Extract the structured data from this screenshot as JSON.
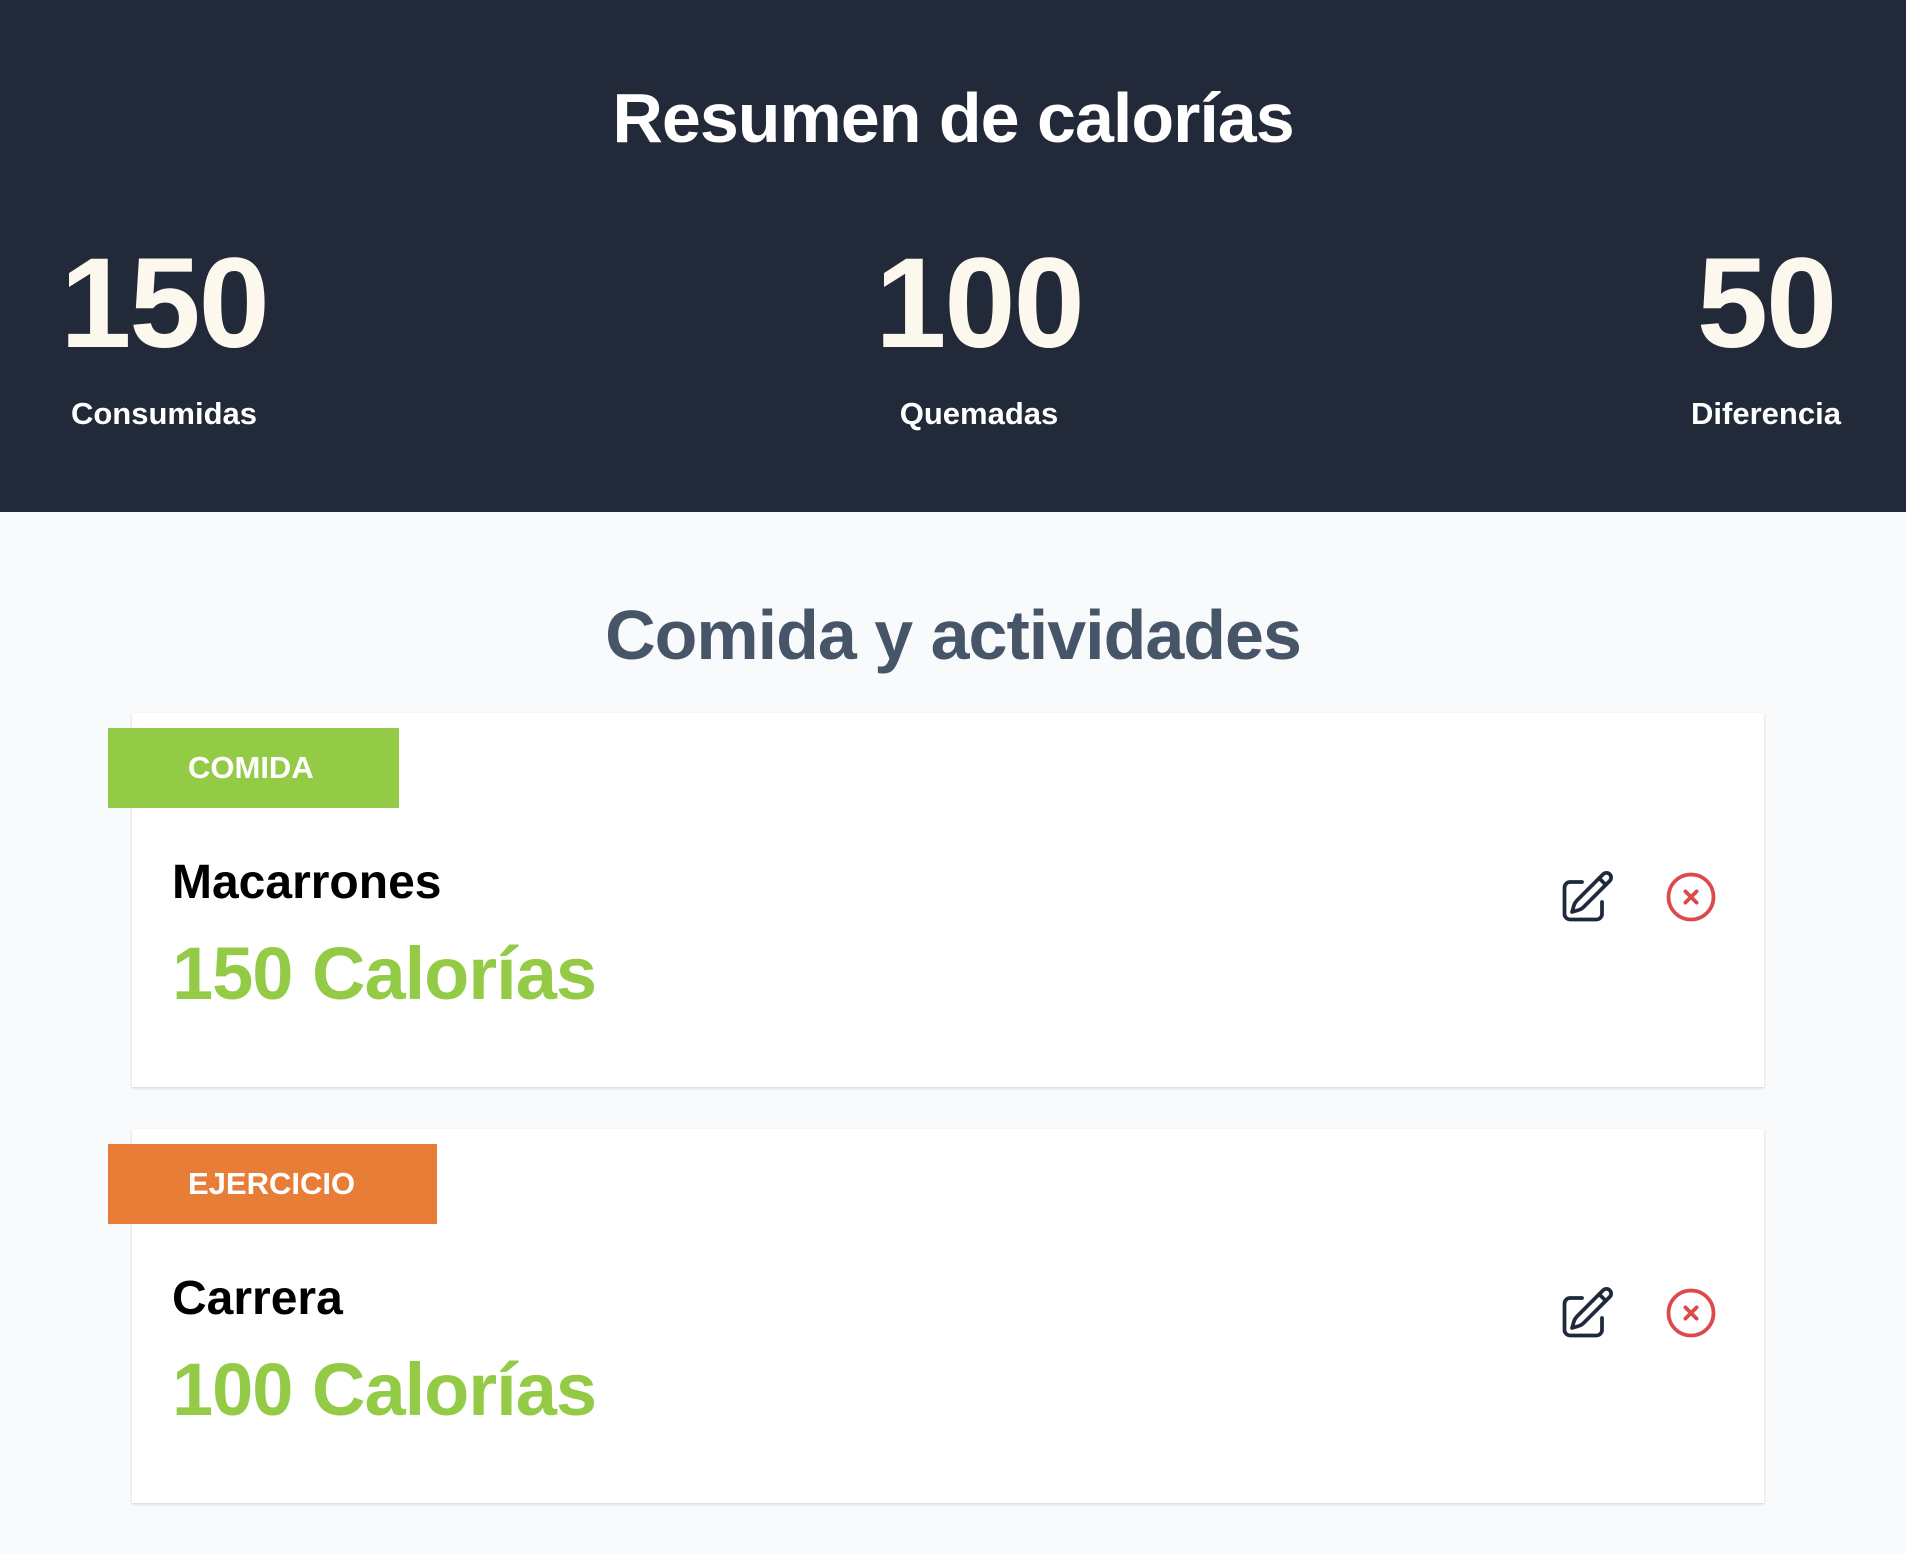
{
  "summary": {
    "title": "Resumen de calorías",
    "stats": [
      {
        "value": "150",
        "label": "Consumidas"
      },
      {
        "value": "100",
        "label": "Quemadas"
      },
      {
        "value": "50",
        "label": "Diferencia"
      }
    ]
  },
  "activities": {
    "title": "Comida y actividades",
    "items": [
      {
        "category": "Comida",
        "name": "Macarrones",
        "calories": "150 Calorías"
      },
      {
        "category": "Ejercicio",
        "name": "Carrera",
        "calories": "100 Calorías"
      }
    ]
  },
  "colors": {
    "header_bg": "#222938",
    "food_badge": "#94cb46",
    "exercise_badge": "#e87d37",
    "calories_text": "#94cb46",
    "delete_icon": "#dc4b4b"
  },
  "icons": {
    "edit": "pencil-square-icon",
    "delete": "x-circle-icon"
  }
}
